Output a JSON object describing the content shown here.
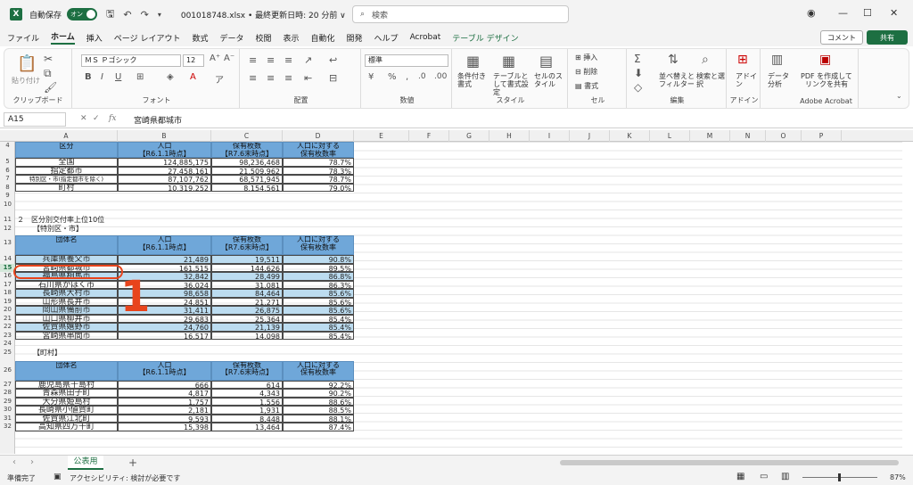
{
  "titlebar": {
    "autosave_label": "自動保存",
    "autosave_state": "オン",
    "file_info": "001018748.xlsx • 最終更新日時: 20 分前 ∨",
    "search_placeholder": "検索",
    "zoom_icon": "account-icon"
  },
  "tabs": [
    "ファイル",
    "ホーム",
    "挿入",
    "ページ レイアウト",
    "数式",
    "データ",
    "校閲",
    "表示",
    "自動化",
    "開発",
    "ヘルプ",
    "Acrobat",
    "テーブル デザイン"
  ],
  "comment_label": "コメント",
  "share_label": "共有",
  "ribbon": {
    "clipboard": {
      "paste": "貼り付け",
      "label": "クリップボード"
    },
    "font": {
      "name": "ＭＳ Ｐゴシック",
      "size": "12",
      "label": "フォント"
    },
    "align": {
      "label": "配置"
    },
    "number": {
      "format": "標準",
      "label": "数値"
    },
    "style": {
      "cond": "条件付き書式",
      "table": "テーブルとして書式設定",
      "cell": "セルのスタイル",
      "label": "スタイル"
    },
    "cells": {
      "insert": "挿入",
      "delete": "削除",
      "format": "書式",
      "label": "セル"
    },
    "edit": {
      "sort": "並べ替えとフィルター",
      "find": "検索と選択",
      "label": "編集"
    },
    "addin": {
      "btn": "アドイン",
      "label": "アドイン"
    },
    "analysis": {
      "btn": "データ分析"
    },
    "adobe": {
      "btn": "PDF を作成してリンクを共有",
      "label": "Adobe Acrobat"
    }
  },
  "formula_bar": {
    "cell_ref": "A15",
    "fx": "fx",
    "value": "宮崎県都城市"
  },
  "columns": [
    "A",
    "B",
    "C",
    "D",
    "E",
    "F",
    "G",
    "H",
    "I",
    "J",
    "K",
    "L",
    "M",
    "N",
    "O",
    "P"
  ],
  "table1": {
    "header": [
      "区分",
      "人口\n【R6.1.1時点】",
      "保有枚数\n【R7.6末時点】",
      "人口に対する\n保有枚数率"
    ],
    "rows": [
      {
        "row": "5",
        "name": "全国",
        "pop": "124,885,175",
        "count": "98,236,468",
        "rate": "78.7%"
      },
      {
        "row": "6",
        "name": "指定都市",
        "pop": "27,458,161",
        "count": "21,509,962",
        "rate": "78.3%"
      },
      {
        "row": "7",
        "name": "特別区・市(指定都市を除く)",
        "pop": "87,107,762",
        "count": "68,571,945",
        "rate": "78.7%"
      },
      {
        "row": "8",
        "name": "町村",
        "pop": "10,319,252",
        "count": "8,154,561",
        "rate": "79.0%"
      }
    ]
  },
  "section2_title": "２　区分別交付率上位10位",
  "section2_sub": "【特別区・市】",
  "table2": {
    "header": [
      "団体名",
      "人口\n【R6.1.1時点】",
      "保有枚数\n【R7.6末時点】",
      "人口に対する\n保有枚数率"
    ],
    "rows": [
      {
        "row": "14",
        "name": "兵庫県養父市",
        "pop": "21,489",
        "count": "19,511",
        "rate": "90.8%"
      },
      {
        "row": "15",
        "name": "宮崎県都城市",
        "pop": "161,515",
        "count": "144,626",
        "rate": "89.5%"
      },
      {
        "row": "16",
        "name": "福島県相馬市",
        "pop": "32,842",
        "count": "28,499",
        "rate": "86.8%"
      },
      {
        "row": "17",
        "name": "石川県かほく市",
        "pop": "36,024",
        "count": "31,081",
        "rate": "86.3%"
      },
      {
        "row": "18",
        "name": "長崎県大村市",
        "pop": "98,658",
        "count": "84,464",
        "rate": "85.6%"
      },
      {
        "row": "19",
        "name": "山形県長井市",
        "pop": "24,851",
        "count": "21,271",
        "rate": "85.6%"
      },
      {
        "row": "20",
        "name": "岡山県備前市",
        "pop": "31,411",
        "count": "26,875",
        "rate": "85.6%"
      },
      {
        "row": "21",
        "name": "山口県柳井市",
        "pop": "29,683",
        "count": "25,364",
        "rate": "85.4%"
      },
      {
        "row": "22",
        "name": "佐賀県嬉野市",
        "pop": "24,760",
        "count": "21,139",
        "rate": "85.4%"
      },
      {
        "row": "23",
        "name": "宮崎県串間市",
        "pop": "16,517",
        "count": "14,098",
        "rate": "85.4%"
      }
    ]
  },
  "section3_sub": "【町村】",
  "table3": {
    "header": [
      "団体名",
      "人口\n【R6.1.1時点】",
      "保有枚数\n【R7.6末時点】",
      "人口に対する\n保有枚数率"
    ],
    "rows": [
      {
        "row": "27",
        "name": "鹿児島県十島村",
        "pop": "666",
        "count": "614",
        "rate": "92.2%"
      },
      {
        "row": "28",
        "name": "青森県田子町",
        "pop": "4,817",
        "count": "4,343",
        "rate": "90.2%"
      },
      {
        "row": "29",
        "name": "大分県姫島村",
        "pop": "1,757",
        "count": "1,556",
        "rate": "88.6%"
      },
      {
        "row": "30",
        "name": "長崎県小値賀町",
        "pop": "2,181",
        "count": "1,931",
        "rate": "88.5%"
      },
      {
        "row": "31",
        "name": "佐賀県江北町",
        "pop": "9,593",
        "count": "8,448",
        "rate": "88.1%"
      },
      {
        "row": "32",
        "name": "高知県四万十町",
        "pop": "15,398",
        "count": "13,464",
        "rate": "87.4%"
      }
    ]
  },
  "annotation_number": "1",
  "sheet_tab": "公表用",
  "status": {
    "ready": "準備完了",
    "accessibility": "アクセシビリティ: 検討が必要です",
    "zoom": "87%"
  }
}
